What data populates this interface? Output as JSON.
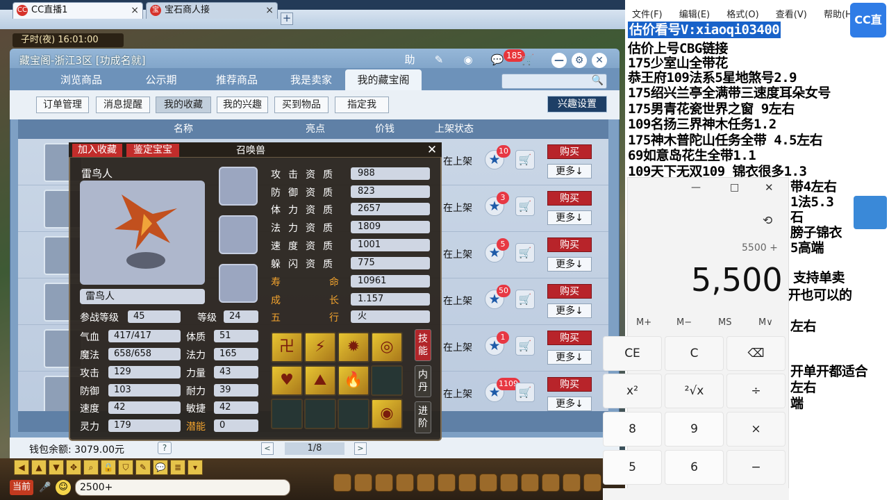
{
  "browser": {
    "tabs": [
      {
        "icon": "CC",
        "label": "CC直播1"
      },
      {
        "icon": "宝",
        "label": "宝石商人接"
      }
    ],
    "new_tab": "+",
    "window_buttons": [
      "—",
      "□",
      "✕"
    ]
  },
  "game": {
    "time": "子时(夜)  16:01:00",
    "chat_channel": "当前",
    "chat_input": "2500+"
  },
  "window": {
    "title": "藏宝阁-浙江3区 [功成名就]",
    "message_count": "185",
    "tools": {
      "help": "助"
    },
    "tabs": [
      "浏览商品",
      "公示期",
      "推荐商品",
      "我是卖家",
      "我的藏宝阁"
    ],
    "subtabs": [
      "订单管理",
      "消息提醒",
      "我的收藏",
      "我的兴趣",
      "买到物品",
      "指定我"
    ],
    "interest_button": "兴趣设置",
    "list_headers": [
      "名称",
      "亮点",
      "价钱",
      "上架状态"
    ],
    "rows": [
      {
        "status": "在上架",
        "favorites": "10",
        "buy": "购买",
        "more": "更多↓"
      },
      {
        "status": "在上架",
        "favorites": "3",
        "buy": "购买",
        "more": "更多↓"
      },
      {
        "status": "在上架",
        "favorites": "5",
        "buy": "购买",
        "more": "更多↓"
      },
      {
        "status": "在上架",
        "favorites": "50",
        "buy": "购买",
        "more": "更多↓"
      },
      {
        "status": "在上架",
        "favorites": "1",
        "buy": "购买",
        "more": "更多↓"
      },
      {
        "status": "在上架",
        "favorites": "1109",
        "buy": "购买",
        "more": "更多↓"
      }
    ],
    "wallet": "钱包余额: 3079.00元",
    "help": "?",
    "page": "1/8",
    "prev": "<",
    "next": ">"
  },
  "popup": {
    "add_fav": "加入收藏",
    "appraise": "鉴定宝宝",
    "title": "召唤兽",
    "close": "✕",
    "pet_name": "雷鸟人",
    "pet_name_field": "雷鸟人",
    "battle_level_label": "参战等级",
    "battle_level": "45",
    "level_label": "等级",
    "level": "24",
    "left_stats": [
      {
        "label": "气血",
        "value": "417/417"
      },
      {
        "label": "魔法",
        "value": "658/658"
      },
      {
        "label": "攻击",
        "value": "129"
      },
      {
        "label": "防御",
        "value": "103"
      },
      {
        "label": "速度",
        "value": "42"
      },
      {
        "label": "灵力",
        "value": "179"
      }
    ],
    "right_stats": [
      {
        "label": "体质",
        "value": "51"
      },
      {
        "label": "法力",
        "value": "165"
      },
      {
        "label": "力量",
        "value": "43"
      },
      {
        "label": "耐力",
        "value": "39"
      },
      {
        "label": "敏捷",
        "value": "42"
      },
      {
        "label": "潜能",
        "value": "0"
      }
    ],
    "aptitudes": [
      {
        "label": "攻击资质",
        "value": "988"
      },
      {
        "label": "防御资质",
        "value": "823"
      },
      {
        "label": "体力资质",
        "value": "2657"
      },
      {
        "label": "法力资质",
        "value": "1809"
      },
      {
        "label": "速度资质",
        "value": "1001"
      },
      {
        "label": "躲闪资质",
        "value": "775"
      }
    ],
    "gold_attrs": [
      {
        "l1": "寿",
        "l2": "命",
        "value": "10961"
      },
      {
        "l1": "成",
        "l2": "长",
        "value": "1.157"
      },
      {
        "l1": "五",
        "l2": "行",
        "value": "火"
      }
    ],
    "side_tabs": [
      "技能",
      "内丹",
      "进阶"
    ]
  },
  "right_panel": {
    "menu": [
      "文件(F)",
      "编辑(E)",
      "格式(O)",
      "查看(V)",
      "帮助(H)"
    ],
    "logo": "CC直播",
    "lines": [
      "估价看号V:xiaoqi03400",
      "估价上号CBG链接",
      "175少室山全带花",
      "恭王府109法系5星地煞号2.9",
      "175绍兴兰亭全满带三速度耳朵女号",
      "175男青花瓷世界之窗  9左右",
      "109名扬三界神木任务1.2",
      "175神木普陀山任务全带 4.5左右",
      "69如意岛花生全带1.1",
      "109天下无双109  锦衣很多1.3",
      "带4左右",
      "1法5.3",
      "石",
      "膀子锦衣",
      "5高端",
      "支持单卖",
      "开也可以的",
      "左右",
      "开单开都适合",
      "左右",
      "端"
    ]
  },
  "calculator": {
    "min": "—",
    "max": "□",
    "close": "✕",
    "history_icon": "⟲",
    "expression": "5500 +",
    "display": "5,500",
    "memory": [
      "M+",
      "M−",
      "MS",
      "M∨"
    ],
    "keys": [
      "CE",
      "C",
      "⌫",
      "x²",
      "²√x",
      "÷",
      "8",
      "9",
      "×",
      "5",
      "6",
      "−"
    ]
  }
}
